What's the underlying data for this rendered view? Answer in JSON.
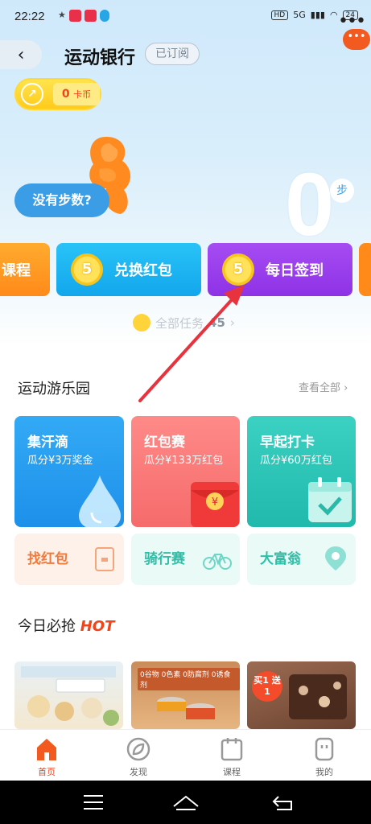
{
  "status": {
    "time": "22:22",
    "network": "5G",
    "hd": "HD",
    "battery": "24"
  },
  "header": {
    "back": "‹",
    "title": "运动银行",
    "subscribed": "已订阅",
    "more": "•••",
    "badge": "•••"
  },
  "coins": {
    "value": "0",
    "unit": "卡币"
  },
  "steps": {
    "no_steps": "没有步数?",
    "count": "0",
    "unit": "步"
  },
  "task_cards": [
    {
      "label": "课程"
    },
    {
      "num": "5",
      "label": "兑换红包"
    },
    {
      "num": "5",
      "label": "每日签到"
    }
  ],
  "all_tasks": {
    "label": "全部任务",
    "count": "45",
    "chevron": "›"
  },
  "playground": {
    "title": "运动游乐园",
    "see_all": "查看全部 ›",
    "tiles": [
      {
        "title": "集汗滴",
        "sub": "瓜分¥3万奖金"
      },
      {
        "title": "红包赛",
        "sub": "瓜分¥133万红包"
      },
      {
        "title": "早起打卡",
        "sub": "瓜分¥60万红包"
      }
    ],
    "small": [
      {
        "title": "找红包"
      },
      {
        "title": "骑行赛"
      },
      {
        "title": "大富翁"
      }
    ]
  },
  "today": {
    "title": "今日必抢",
    "hot": "HOT",
    "p2_text": "0谷物 0色素 0防腐剂 0诱食剂",
    "p3_text": "买1 送1"
  },
  "tabs": [
    {
      "label": "首页",
      "icon": "home-icon"
    },
    {
      "label": "发现",
      "icon": "discover-icon"
    },
    {
      "label": "课程",
      "icon": "calendar-icon"
    },
    {
      "label": "我的",
      "icon": "profile-icon"
    }
  ],
  "colors": {
    "accent": "#f2441b",
    "blue": "#12a6ec",
    "purple": "#8e32e6",
    "arrow": "#e8333f"
  }
}
